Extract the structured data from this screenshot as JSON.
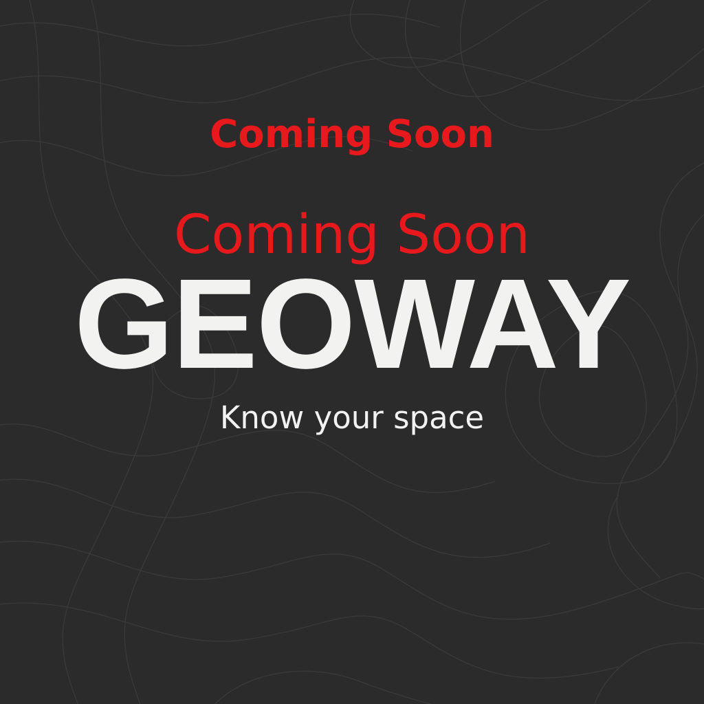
{
  "headings": {
    "coming_soon_small": "Coming Soon",
    "coming_soon_large": "Coming Soon"
  },
  "brand": {
    "name": "GEOWAY",
    "tagline": "Know your space"
  },
  "colors": {
    "background": "#2b2b2b",
    "contour_lines": "#3a3a3a",
    "accent_red": "#e8191d",
    "brand_text": "#f2f2f0",
    "tagline_text": "#f2f2f2"
  },
  "background_pattern": "topographic-contour-lines"
}
